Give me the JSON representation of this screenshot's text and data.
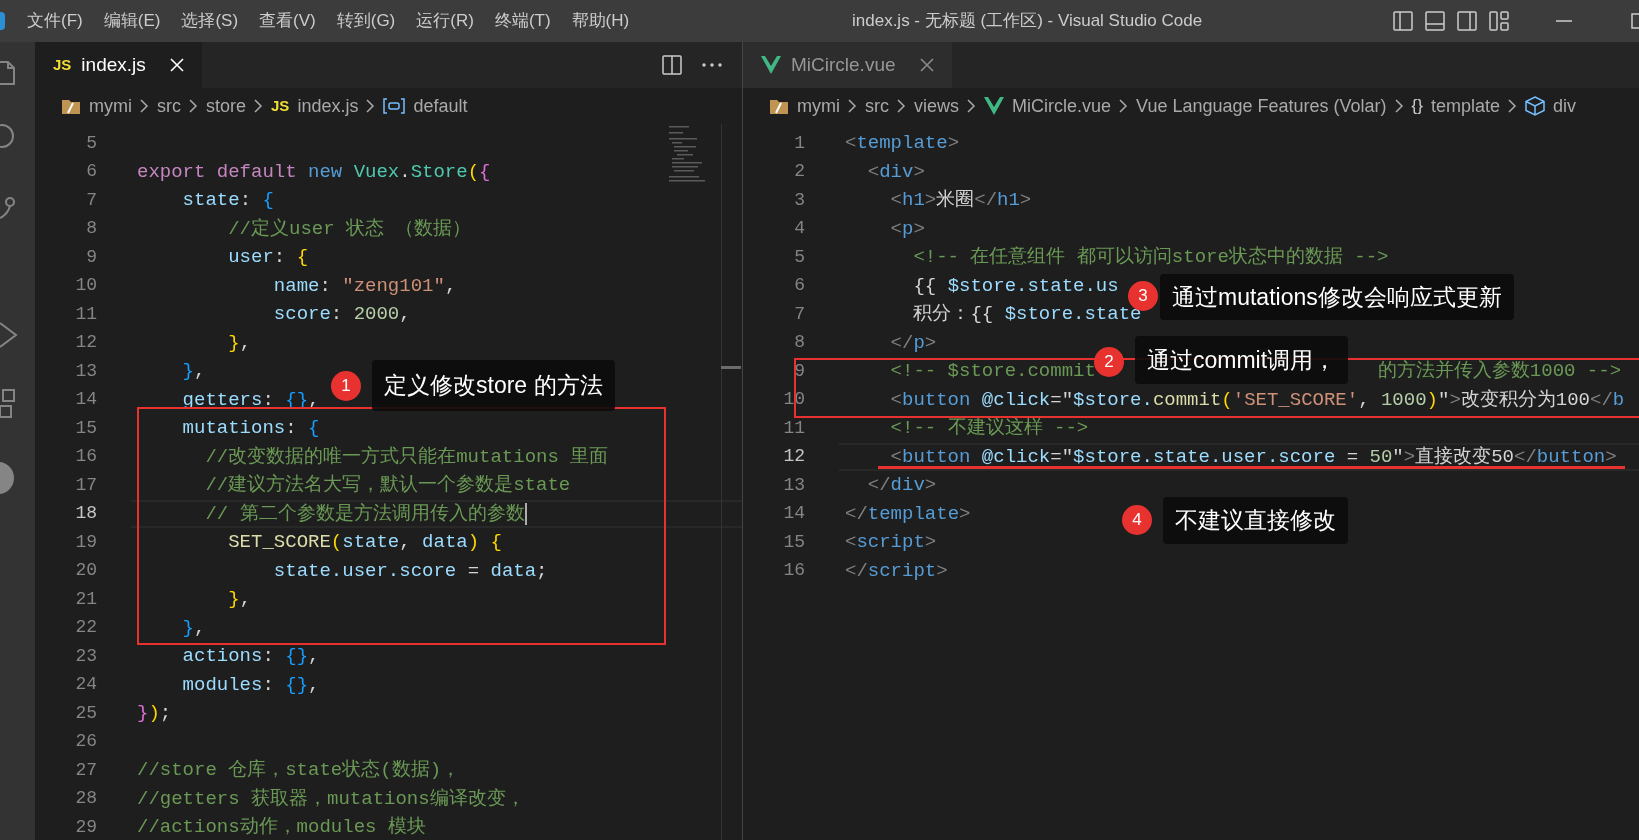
{
  "title_bar": {
    "menu": [
      "文件(F)",
      "编辑(E)",
      "选择(S)",
      "查看(V)",
      "转到(G)",
      "运行(R)",
      "终端(T)",
      "帮助(H)"
    ],
    "title": "index.js - 无标题 (工作区) - Visual Studio Code"
  },
  "left_editor": {
    "tabs": [
      {
        "label": "index.js",
        "badge": "JS",
        "kind": "js",
        "selected": true
      }
    ],
    "breadcrumbs": [
      {
        "text": "mymi",
        "kind": "folder"
      },
      {
        "text": "src",
        "kind": "plain"
      },
      {
        "text": "store",
        "kind": "plain"
      },
      {
        "text": "index.js",
        "kind": "js",
        "badge": "JS"
      },
      {
        "text": "default",
        "kind": "variable"
      }
    ],
    "lines": [
      {
        "n": "5",
        "current": false
      },
      {
        "n": "6",
        "current": false,
        "segs": [
          {
            "text": "export default ",
            "kind": "kw"
          },
          {
            "text": "new ",
            "kind": "storage"
          },
          {
            "text": "Vuex",
            "kind": "cls"
          },
          {
            "text": ".",
            "kind": "p"
          },
          {
            "text": "Store",
            "kind": "cls"
          },
          {
            "text": "(",
            "kind": "b1"
          },
          {
            "text": "{",
            "kind": "b2"
          }
        ]
      },
      {
        "n": "7",
        "current": false,
        "segs": [
          {
            "text": "    state",
            "kind": "prop"
          },
          {
            "text": ": ",
            "kind": "p"
          },
          {
            "text": "{",
            "kind": "b3"
          }
        ]
      },
      {
        "n": "8",
        "current": false,
        "segs": [
          {
            "text": "        //定义user 状态 （数据）",
            "kind": "cmt"
          }
        ]
      },
      {
        "n": "9",
        "current": false,
        "segs": [
          {
            "text": "        user",
            "kind": "prop"
          },
          {
            "text": ": ",
            "kind": "p"
          },
          {
            "text": "{",
            "kind": "b1"
          }
        ]
      },
      {
        "n": "10",
        "current": false,
        "segs": [
          {
            "text": "            name",
            "kind": "prop"
          },
          {
            "text": ": ",
            "kind": "p"
          },
          {
            "text": "\"zeng101\"",
            "kind": "str"
          },
          {
            "text": ",",
            "kind": "p"
          }
        ]
      },
      {
        "n": "11",
        "current": false,
        "segs": [
          {
            "text": "            score",
            "kind": "prop"
          },
          {
            "text": ": ",
            "kind": "p"
          },
          {
            "text": "2000",
            "kind": "num"
          },
          {
            "text": ",",
            "kind": "p"
          }
        ]
      },
      {
        "n": "12",
        "current": false,
        "segs": [
          {
            "text": "        }",
            "kind": "b1"
          },
          {
            "text": ",",
            "kind": "p"
          }
        ]
      },
      {
        "n": "13",
        "current": false,
        "segs": [
          {
            "text": "    }",
            "kind": "b3"
          },
          {
            "text": ",",
            "kind": "p"
          }
        ]
      },
      {
        "n": "14",
        "current": false,
        "segs": [
          {
            "text": "    getters",
            "kind": "prop"
          },
          {
            "text": ": ",
            "kind": "p"
          },
          {
            "text": "{}",
            "kind": "b3"
          },
          {
            "text": ",",
            "kind": "p"
          }
        ]
      },
      {
        "n": "15",
        "current": false,
        "segs": [
          {
            "text": "    mutations",
            "kind": "prop"
          },
          {
            "text": ": ",
            "kind": "p"
          },
          {
            "text": "{",
            "kind": "b3"
          }
        ]
      },
      {
        "n": "16",
        "current": false,
        "segs": [
          {
            "text": "      //改变数据的唯一方式只能在mutations 里面",
            "kind": "cmt"
          }
        ]
      },
      {
        "n": "17",
        "current": false,
        "segs": [
          {
            "text": "      //建议方法名大写，默认一个参数是state",
            "kind": "cmt"
          }
        ]
      },
      {
        "n": "18",
        "current": true,
        "segs": [
          {
            "text": "      // 第二个参数是方法调用传入的参数",
            "kind": "cmt"
          }
        ]
      },
      {
        "n": "19",
        "current": false,
        "segs": [
          {
            "text": "        SET_SCORE",
            "kind": "fn"
          },
          {
            "text": "(",
            "kind": "b1"
          },
          {
            "text": "state",
            "kind": "var"
          },
          {
            "text": ", ",
            "kind": "p"
          },
          {
            "text": "data",
            "kind": "var"
          },
          {
            "text": ") {",
            "kind": "b1"
          }
        ]
      },
      {
        "n": "20",
        "current": false,
        "segs": [
          {
            "text": "            state.user.score",
            "kind": "var"
          },
          {
            "text": " = ",
            "kind": "p"
          },
          {
            "text": "data",
            "kind": "var"
          },
          {
            "text": ";",
            "kind": "p"
          }
        ]
      },
      {
        "n": "21",
        "current": false,
        "segs": [
          {
            "text": "        }",
            "kind": "b1"
          },
          {
            "text": ",",
            "kind": "p"
          }
        ]
      },
      {
        "n": "22",
        "current": false,
        "segs": [
          {
            "text": "    }",
            "kind": "b3"
          },
          {
            "text": ",",
            "kind": "p"
          }
        ]
      },
      {
        "n": "23",
        "current": false,
        "segs": [
          {
            "text": "    actions",
            "kind": "prop"
          },
          {
            "text": ": ",
            "kind": "p"
          },
          {
            "text": "{}",
            "kind": "b3"
          },
          {
            "text": ",",
            "kind": "p"
          }
        ]
      },
      {
        "n": "24",
        "current": false,
        "segs": [
          {
            "text": "    modules",
            "kind": "prop"
          },
          {
            "text": ": ",
            "kind": "p"
          },
          {
            "text": "{}",
            "kind": "b3"
          },
          {
            "text": ",",
            "kind": "p"
          }
        ]
      },
      {
        "n": "25",
        "current": false,
        "segs": [
          {
            "text": "}",
            "kind": "b2"
          },
          {
            "text": ")",
            "kind": "b1"
          },
          {
            "text": ";",
            "kind": "p"
          }
        ]
      },
      {
        "n": "26",
        "current": false
      },
      {
        "n": "27",
        "current": false,
        "segs": [
          {
            "text": "//store 仓库，state状态(数据)，",
            "kind": "cmt"
          }
        ]
      },
      {
        "n": "28",
        "current": false,
        "segs": [
          {
            "text": "//getters 获取器，mutations编译改变，",
            "kind": "cmt"
          }
        ]
      },
      {
        "n": "29",
        "current": false,
        "segs": [
          {
            "text": "//actions动作，modules 模块",
            "kind": "cmt"
          }
        ]
      }
    ]
  },
  "right_editor": {
    "tabs": [
      {
        "label": "MiCircle.vue",
        "kind": "vue",
        "selected": false
      }
    ],
    "breadcrumbs": [
      {
        "text": "mymi",
        "kind": "folder"
      },
      {
        "text": "src",
        "kind": "plain"
      },
      {
        "text": "views",
        "kind": "plain"
      },
      {
        "text": "MiCircle.vue",
        "kind": "vue"
      },
      {
        "text": "Vue Language Features (Volar)",
        "kind": "plain"
      },
      {
        "text": "template",
        "kind": "symbol",
        "badge": "{}"
      },
      {
        "text": "div",
        "kind": "element"
      }
    ],
    "lines": [
      {
        "n": "1",
        "current": false,
        "segs": [
          {
            "text": "<",
            "kind": "tag"
          },
          {
            "text": "template",
            "kind": "tagname"
          },
          {
            "text": ">",
            "kind": "tag"
          }
        ]
      },
      {
        "n": "2",
        "current": false,
        "segs": [
          {
            "text": "  <",
            "kind": "tag"
          },
          {
            "text": "div",
            "kind": "tagname"
          },
          {
            "text": ">",
            "kind": "tag"
          }
        ]
      },
      {
        "n": "3",
        "current": false,
        "segs": [
          {
            "text": "    <",
            "kind": "tag"
          },
          {
            "text": "h1",
            "kind": "tagname"
          },
          {
            "text": ">",
            "kind": "tag"
          },
          {
            "text": "米圈",
            "kind": "text"
          },
          {
            "text": "</",
            "kind": "tag"
          },
          {
            "text": "h1",
            "kind": "tagname"
          },
          {
            "text": ">",
            "kind": "tag"
          }
        ]
      },
      {
        "n": "4",
        "current": false,
        "segs": [
          {
            "text": "    <",
            "kind": "tag"
          },
          {
            "text": "p",
            "kind": "tagname"
          },
          {
            "text": ">",
            "kind": "tag"
          }
        ]
      },
      {
        "n": "5",
        "current": false,
        "segs": [
          {
            "text": "      <!-- 在任意组件 都可以访问store状态中的数据 -->",
            "kind": "cmt"
          }
        ]
      },
      {
        "n": "6",
        "current": false,
        "segs": [
          {
            "text": "      {{ ",
            "kind": "p"
          },
          {
            "text": "$store.state.us",
            "kind": "var"
          }
        ]
      },
      {
        "n": "7",
        "current": false,
        "segs": [
          {
            "text": "      积分：",
            "kind": "text"
          },
          {
            "text": "{{ ",
            "kind": "p"
          },
          {
            "text": "$store.state",
            "kind": "var"
          }
        ]
      },
      {
        "n": "8",
        "current": false,
        "segs": [
          {
            "text": "    </",
            "kind": "tag"
          },
          {
            "text": "p",
            "kind": "tagname"
          },
          {
            "text": ">",
            "kind": "tag"
          }
        ]
      },
      {
        "n": "9",
        "current": false,
        "segs": [
          {
            "text": "    <!-- $store.commit",
            "kind": "cmt"
          },
          {
            "kind": "gap"
          },
          {
            "text": "的方法并传入参数1000 -->",
            "kind": "cmt"
          }
        ]
      },
      {
        "n": "10",
        "current": false,
        "segs": [
          {
            "text": "    <",
            "kind": "tag"
          },
          {
            "text": "button",
            "kind": "tagname"
          },
          {
            "text": " @click",
            "kind": "attr"
          },
          {
            "text": "=\"",
            "kind": "p"
          },
          {
            "text": "$store.",
            "kind": "var"
          },
          {
            "text": "commit",
            "kind": "fn"
          },
          {
            "text": "(",
            "kind": "b1"
          },
          {
            "text": "'SET_SCORE'",
            "kind": "str"
          },
          {
            "text": ", ",
            "kind": "p"
          },
          {
            "text": "1000",
            "kind": "num"
          },
          {
            "text": ")",
            "kind": "b1"
          },
          {
            "text": "\"",
            "kind": "p"
          },
          {
            "text": ">",
            "kind": "tag"
          },
          {
            "text": "改变积分为100",
            "kind": "text"
          },
          {
            "text": "</",
            "kind": "tag"
          },
          {
            "text": "b",
            "kind": "tagname"
          }
        ]
      },
      {
        "n": "11",
        "current": false,
        "segs": [
          {
            "text": "    <!-- 不建议这样 -->",
            "kind": "cmt"
          }
        ]
      },
      {
        "n": "12",
        "current": true,
        "segs": [
          {
            "text": "    <",
            "kind": "tag"
          },
          {
            "text": "button",
            "kind": "tagname"
          },
          {
            "text": " @click",
            "kind": "attr"
          },
          {
            "text": "=\"",
            "kind": "p"
          },
          {
            "text": "$store.state.user.score",
            "kind": "var"
          },
          {
            "text": " = ",
            "kind": "p"
          },
          {
            "text": "50",
            "kind": "num"
          },
          {
            "text": "\"",
            "kind": "p"
          },
          {
            "text": ">",
            "kind": "tag"
          },
          {
            "text": "直接改变50",
            "kind": "text"
          },
          {
            "text": "</",
            "kind": "tag"
          },
          {
            "text": "button",
            "kind": "tagname"
          },
          {
            "text": ">",
            "kind": "tag"
          }
        ]
      },
      {
        "n": "13",
        "current": false,
        "segs": [
          {
            "text": "  </",
            "kind": "tag"
          },
          {
            "text": "div",
            "kind": "tagname"
          },
          {
            "text": ">",
            "kind": "tag"
          }
        ]
      },
      {
        "n": "14",
        "current": false,
        "segs": [
          {
            "text": "</",
            "kind": "tag"
          },
          {
            "text": "template",
            "kind": "tagname"
          },
          {
            "text": ">",
            "kind": "tag"
          }
        ]
      },
      {
        "n": "15",
        "current": false,
        "segs": [
          {
            "text": "<",
            "kind": "tag"
          },
          {
            "text": "script",
            "kind": "tagname"
          },
          {
            "text": ">",
            "kind": "tag"
          }
        ]
      },
      {
        "n": "16",
        "current": false,
        "segs": [
          {
            "text": "</",
            "kind": "tag"
          },
          {
            "text": "script",
            "kind": "tagname"
          },
          {
            "text": ">",
            "kind": "tag"
          }
        ]
      }
    ]
  },
  "annotations": [
    {
      "number": "1",
      "text": "定义修改store 的方法"
    },
    {
      "number": "3",
      "text": "通过mutations修改会响应式更新"
    },
    {
      "number": "2",
      "text": "通过commit调用，"
    },
    {
      "number": "4",
      "text": "不建议直接修改"
    }
  ]
}
